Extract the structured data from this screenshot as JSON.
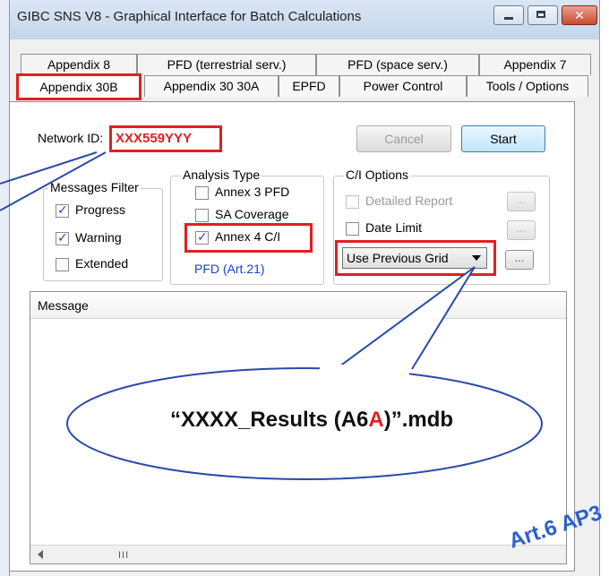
{
  "window": {
    "title": "GIBC SNS V8 - Graphical Interface for Batch Calculations",
    "close_glyph": "✕"
  },
  "tabs": {
    "row1": [
      "Appendix 8",
      "PFD (terrestrial serv.)",
      "PFD (space serv.)",
      "Appendix 7"
    ],
    "row2": [
      "Appendix 30B",
      "Appendix 30 30A",
      "EPFD",
      "Power Control",
      "Tools / Options"
    ],
    "active": "Appendix 30B"
  },
  "network": {
    "label": "Network ID:",
    "value": "XXX559YYY"
  },
  "buttons": {
    "cancel": "Cancel",
    "start": "Start",
    "ellipsis": "..."
  },
  "messages_filter": {
    "title": "Messages Filter",
    "items": [
      {
        "label": "Progress",
        "checked": true
      },
      {
        "label": "Warning",
        "checked": true
      },
      {
        "label": "Extended",
        "checked": false
      }
    ]
  },
  "analysis_type": {
    "title": "Analysis Type",
    "items": [
      {
        "label": "Annex 3 PFD",
        "checked": false
      },
      {
        "label": "SA Coverage",
        "checked": false
      },
      {
        "label": "Annex 4 C/I",
        "checked": true
      }
    ],
    "note": "PFD (Art.21)"
  },
  "ci_options": {
    "title": "C/I Options",
    "items": [
      {
        "label": "Detailed Report",
        "checked": false,
        "disabled": true
      },
      {
        "label": "Date Limit",
        "checked": false,
        "disabled": false
      }
    ],
    "grid_select": "Use Previous Grid"
  },
  "message_panel": {
    "header": "Message",
    "scroll_thumb": "III"
  },
  "callout": {
    "prefix": "“XXXX_Results (A6",
    "highlight": "A",
    "suffix": ")”.mdb"
  },
  "watermark": "Art.6 AP3",
  "colors": {
    "highlight_red": "#e02020",
    "link_blue": "#1b3fd0"
  }
}
